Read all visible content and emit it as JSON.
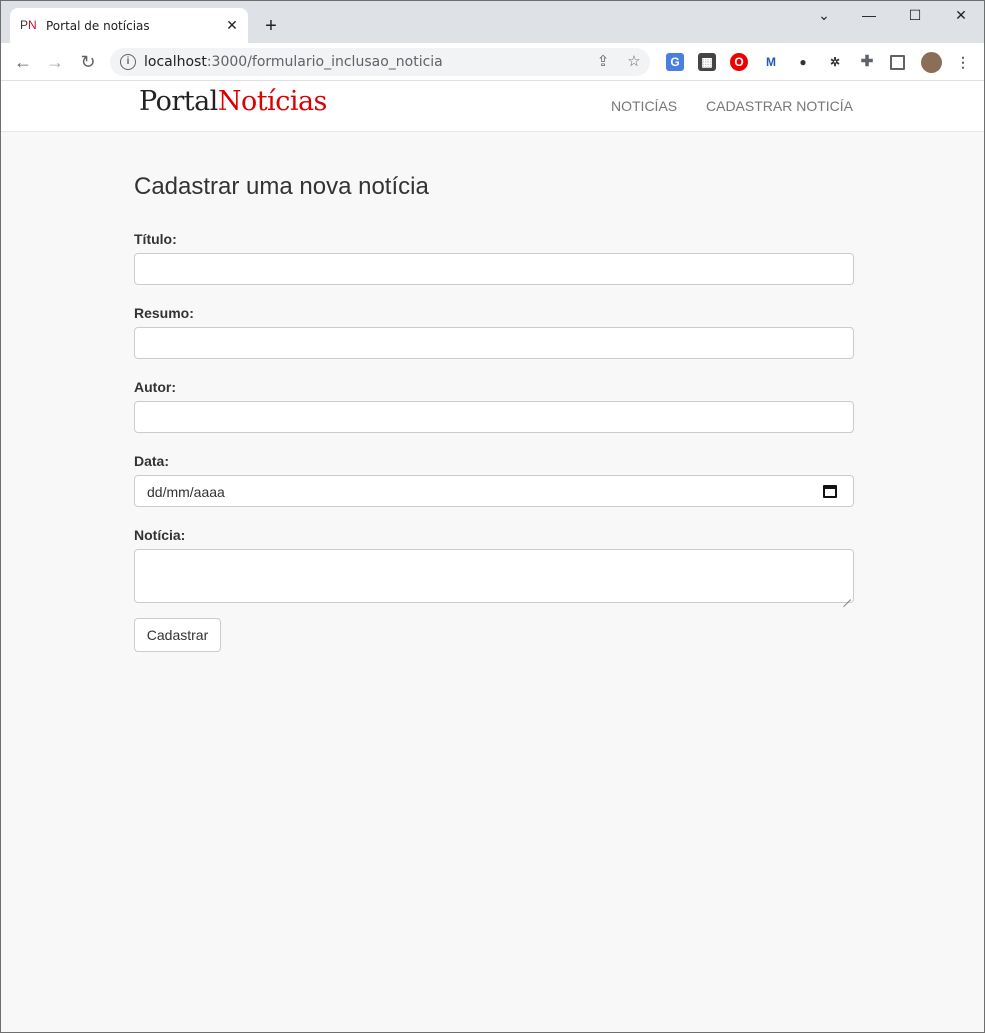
{
  "browser": {
    "tab": {
      "favicon_p": "P",
      "favicon_n": "N",
      "title": "Portal de notícias",
      "close": "✕"
    },
    "new_tab": "+",
    "window_controls": {
      "dropdown": "⌄",
      "minimize": "—",
      "maximize": "☐",
      "close": "✕"
    },
    "nav": {
      "back": "←",
      "forward": "→",
      "reload": "↻"
    },
    "url_host": "localhost",
    "url_rest": ":3000/formulario_inclusao_noticia",
    "icons": [
      "share-icon",
      "star-icon",
      "translate-extension-icon",
      "film-extension-icon",
      "opera-extension-icon",
      "malwarebytes-extension-icon",
      "dots-extension-icon",
      "bug-extension-icon",
      "puzzle-extensions-icon",
      "side-panel-icon",
      "profile-avatar",
      "menu-dots-icon"
    ],
    "colors": {
      "tabstrip": "#dee1e6",
      "omnibox": "#f1f3f4"
    }
  },
  "site": {
    "brand_part1": "Portal",
    "brand_part2": "Notícias",
    "nav": {
      "link1": "NOTICÍAS",
      "link2": "CADASTRAR NOTICÍA"
    },
    "colors": {
      "brand_accent": "#dd0000",
      "nav_text": "#777777"
    }
  },
  "form": {
    "heading": "Cadastrar uma nova notícia",
    "titulo_label": "Título:",
    "titulo_value": "",
    "resumo_label": "Resumo:",
    "resumo_value": "",
    "autor_label": "Autor:",
    "autor_value": "",
    "data_label": "Data:",
    "data_placeholder": "dd/mm/aaaa",
    "noticia_label": "Notícia:",
    "noticia_value": "",
    "submit_label": "Cadastrar"
  }
}
